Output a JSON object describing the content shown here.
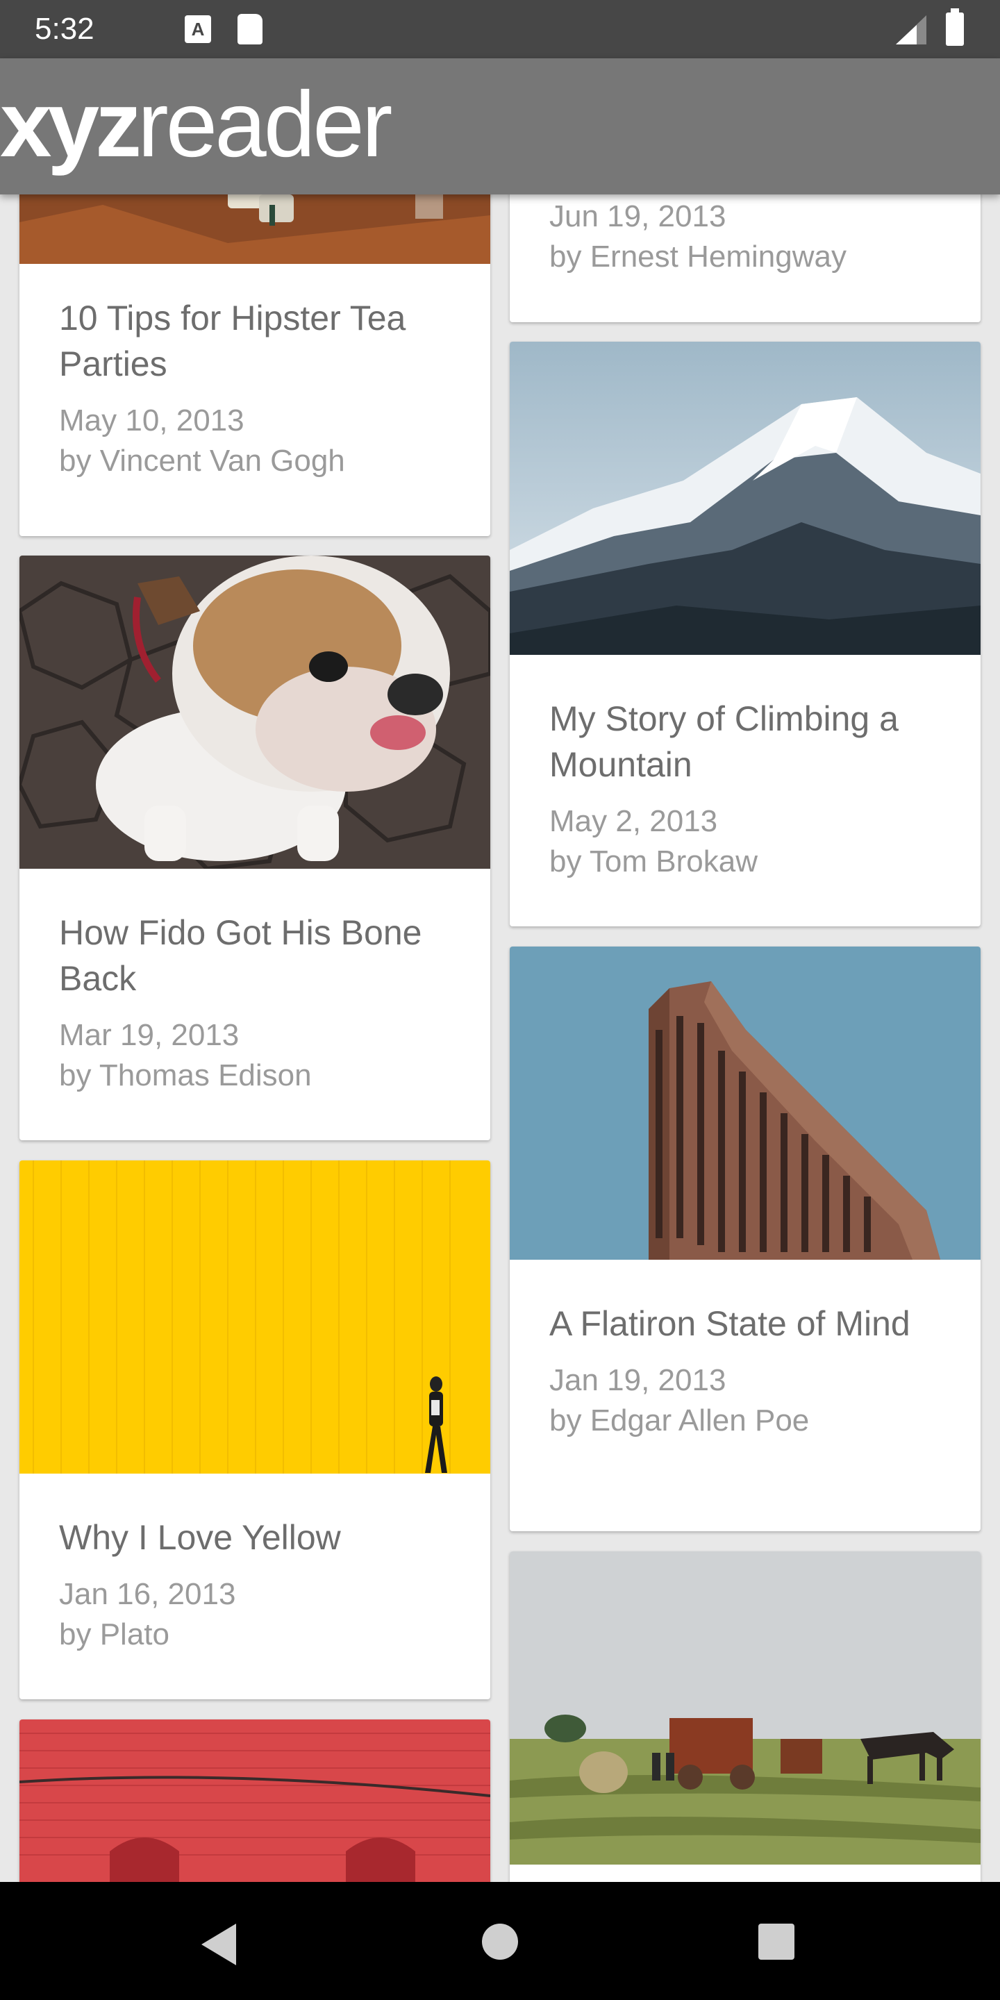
{
  "status_bar": {
    "time": "5:32",
    "notification_a": "A",
    "icons": [
      "a-notification-icon",
      "sd-card-icon",
      "signal-icon",
      "battery-icon"
    ]
  },
  "app_bar": {
    "logo_bold": "xyz",
    "logo_light": "reader",
    "background": "#777777"
  },
  "articles": [
    {
      "title": "",
      "date": "Jun 19, 2013",
      "author": "by Ernest Hemingway",
      "image": "partial"
    },
    {
      "title": "10 Tips for Hipster Tea Parties",
      "date": "May 10, 2013",
      "author": "by Vincent Van Gogh",
      "image": "tea-table"
    },
    {
      "title": "My Story of Climbing a Mountain",
      "date": "May 2, 2013",
      "author": "by Tom Brokaw",
      "image": "snowy-mountain"
    },
    {
      "title": "How Fido Got His Bone Back",
      "date": "Mar 19, 2013",
      "author": "by Thomas Edison",
      "image": "bulldog"
    },
    {
      "title": "A Flatiron State of Mind",
      "date": "Jan 19, 2013",
      "author": "by Edgar Allen Poe",
      "image": "flatiron-building"
    },
    {
      "title": "Why I Love Yellow",
      "date": "Jan 16, 2013",
      "author": "by Plato",
      "image": "yellow-wall"
    },
    {
      "title": "",
      "date": "",
      "author": "",
      "image": "hay-field"
    },
    {
      "title": "",
      "date": "",
      "author": "",
      "image": "red-brick-wall"
    }
  ],
  "nav_bar": {
    "icons": [
      "back-icon",
      "home-icon",
      "recents-icon"
    ]
  }
}
